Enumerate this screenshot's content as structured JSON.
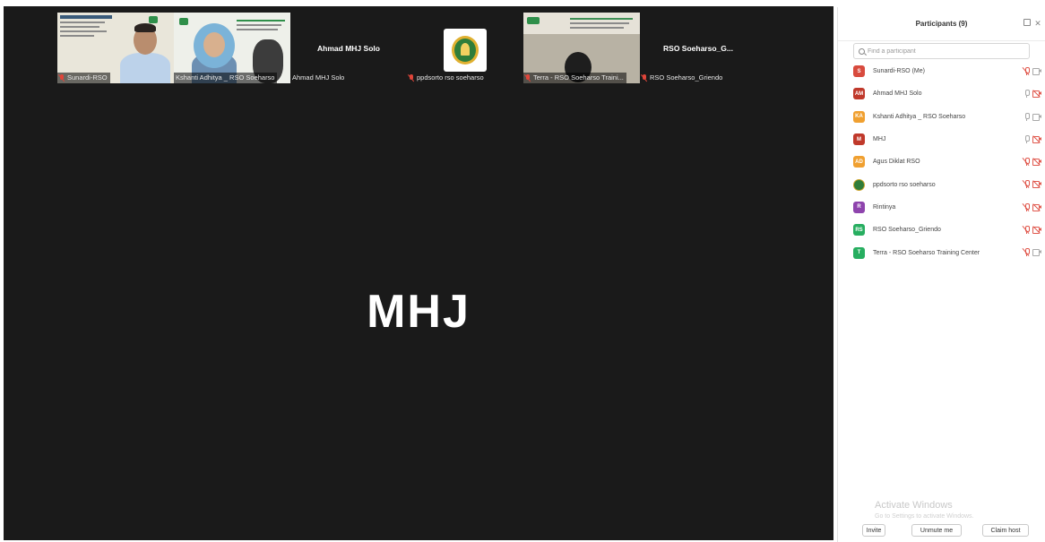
{
  "stage": {
    "active_speaker": "MHJ",
    "thumbnails": [
      {
        "caption": "Sunardi-RSO",
        "muted": true
      },
      {
        "caption": "Kshanti Adhitya _ RSO Soeharso",
        "muted": false
      },
      {
        "caption": "Ahmad MHJ Solo",
        "center_name": "Ahmad MHJ Solo",
        "muted": false
      },
      {
        "caption": "ppdsorto rso soeharso",
        "muted": true
      },
      {
        "caption": "Terra - RSO Soeharso Traini...",
        "muted": true
      },
      {
        "caption": "RSO Soeharso_Griendo",
        "center_name": "RSO Soeharso_G...",
        "muted": true
      }
    ]
  },
  "panel": {
    "title": "Participants (9)",
    "search_placeholder": "Find a participant",
    "participants": [
      {
        "initials": "S",
        "name": "Sunardi-RSO (Me)",
        "color": "#d84b3e",
        "mic": "muted",
        "cam": "on"
      },
      {
        "initials": "AM",
        "name": "Ahmad MHJ Solo",
        "color": "#c0392b",
        "mic": "on",
        "cam": "off"
      },
      {
        "initials": "KA",
        "name": "Kshanti Adhitya _ RSO Soeharso",
        "color": "#f0a030",
        "mic": "on",
        "cam": "on"
      },
      {
        "initials": "M",
        "name": "MHJ",
        "color": "#c0392b",
        "mic": "on",
        "cam": "off"
      },
      {
        "initials": "AD",
        "name": "Agus Diklat RSO",
        "color": "#f0a030",
        "mic": "muted",
        "cam": "off"
      },
      {
        "initials": "",
        "name": "ppdsorto rso soeharso",
        "color": "#2f7d3a",
        "mic": "muted",
        "cam": "off",
        "logo": true
      },
      {
        "initials": "R",
        "name": "Rintinya",
        "color": "#8e44ad",
        "mic": "muted",
        "cam": "off"
      },
      {
        "initials": "RS",
        "name": "RSO Soeharso_Griendo",
        "color": "#27ae60",
        "mic": "muted",
        "cam": "off"
      },
      {
        "initials": "T",
        "name": "Terra - RSO Soeharso Training Center",
        "color": "#27ae60",
        "mic": "muted",
        "cam": "on"
      }
    ],
    "watermark_title": "Activate Windows",
    "watermark_sub": "Go to Settings to activate Windows.",
    "buttons": {
      "invite": "Invite",
      "unmute": "Unmute me",
      "claim_host": "Claim host"
    }
  }
}
